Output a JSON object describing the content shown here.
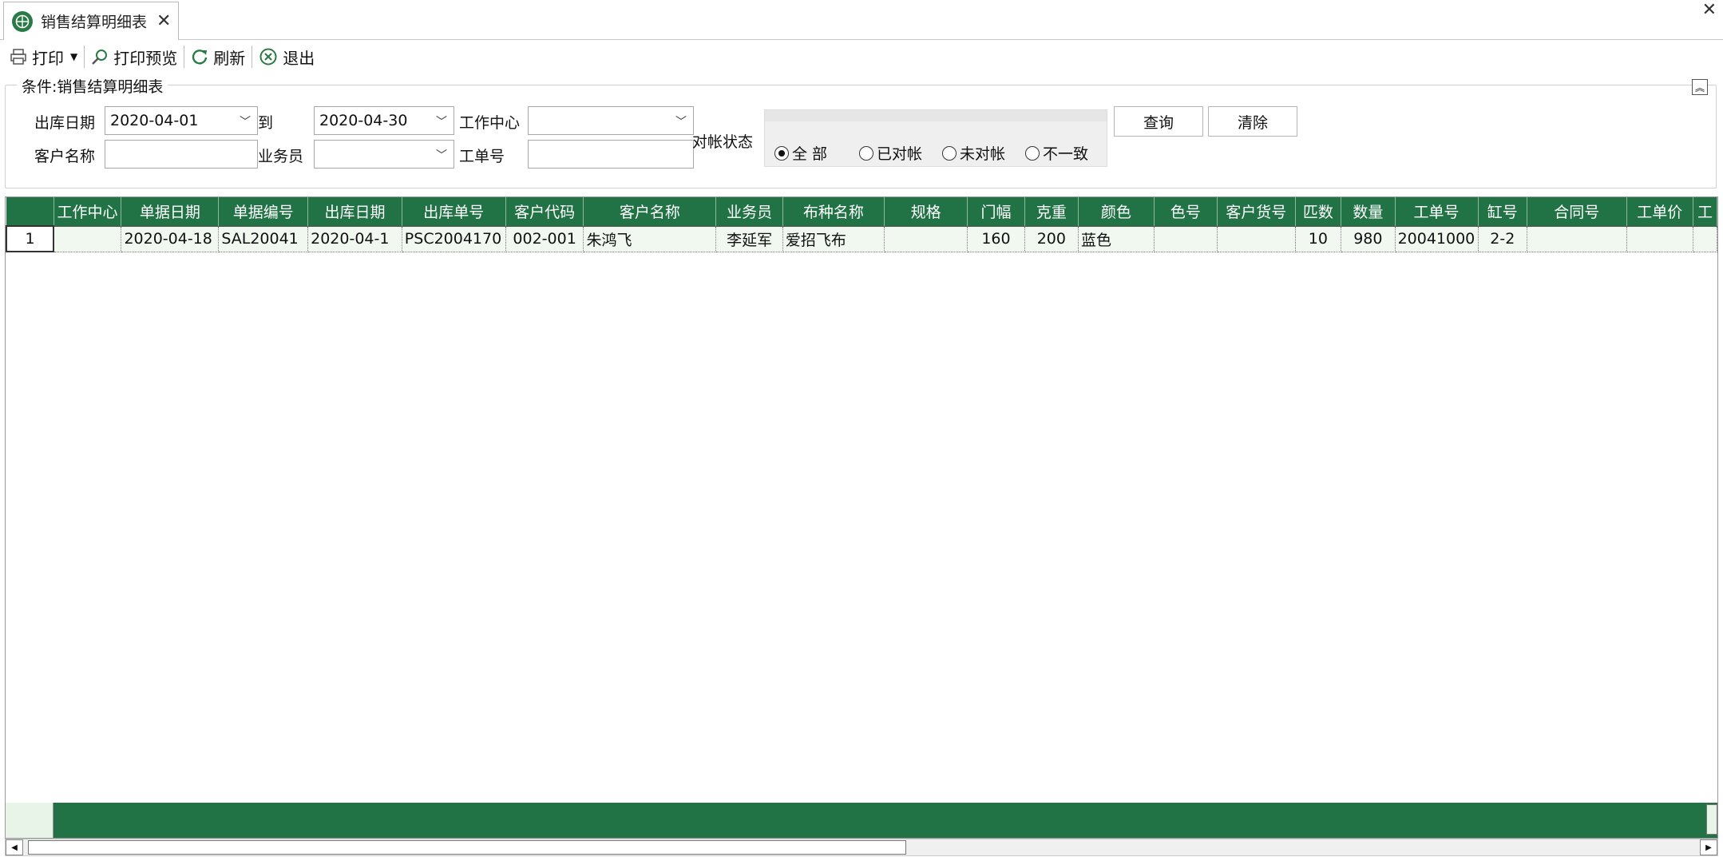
{
  "tab": {
    "title": "销售结算明细表",
    "close": "✕"
  },
  "window": {
    "close": "✕"
  },
  "toolbar": {
    "print": "打印",
    "print_preview": "打印预览",
    "refresh": "刷新",
    "exit": "退出"
  },
  "condition": {
    "title": "条件:销售结算明细表",
    "out_date_label": "出库日期",
    "out_date_from": "2020-04-01",
    "to_label": "到",
    "out_date_to": "2020-04-30",
    "work_center_label": "工作中心",
    "work_center_value": "",
    "customer_name_label": "客户名称",
    "customer_name_value": "",
    "salesman_label": "业务员",
    "salesman_value": "",
    "work_order_label": "工单号",
    "work_order_value": "",
    "reconcile_label": "对帐状态",
    "radios": [
      "全 部",
      "已对帐",
      "未对帐",
      "不一致"
    ],
    "radio_selected": "全 部",
    "query_button": "查询",
    "clear_button": "清除"
  },
  "grid": {
    "columns": [
      "工作中心",
      "单据日期",
      "单据编号",
      "出库日期",
      "出库单号",
      "客户代码",
      "客户名称",
      "业务员",
      "布种名称",
      "规格",
      "门幅",
      "克重",
      "颜色",
      "色号",
      "客户货号",
      "匹数",
      "数量",
      "工单号",
      "缸号",
      "合同号",
      "工单价",
      "工"
    ],
    "rows": [
      {
        "rownum": "1",
        "cells": [
          "",
          "2020-04-18",
          "SAL20041",
          "2020-04-1",
          "PSC2004170",
          "002-001",
          "朱鸿飞",
          "李延军",
          "爱招飞布",
          "",
          "160",
          "200",
          "蓝色",
          "",
          "",
          "10",
          "980",
          "20041000",
          "2-2",
          "",
          "",
          ""
        ]
      }
    ]
  },
  "colors": {
    "header_green": "#217346",
    "row_bg": "#f0f8f0"
  }
}
